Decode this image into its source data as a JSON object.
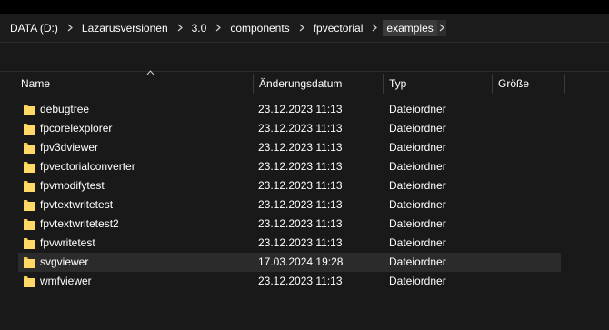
{
  "breadcrumb": {
    "items": [
      "DATA (D:)",
      "Lazarusversionen",
      "3.0",
      "components",
      "fpvectorial",
      "examples"
    ]
  },
  "columns": {
    "name": "Name",
    "date": "Änderungsdatum",
    "type": "Typ",
    "size": "Größe"
  },
  "files": [
    {
      "name": "debugtree",
      "date": "23.12.2023 11:13",
      "type": "Dateiordner",
      "size": ""
    },
    {
      "name": "fpcorelexplorer",
      "date": "23.12.2023 11:13",
      "type": "Dateiordner",
      "size": ""
    },
    {
      "name": "fpv3dviewer",
      "date": "23.12.2023 11:13",
      "type": "Dateiordner",
      "size": ""
    },
    {
      "name": "fpvectorialconverter",
      "date": "23.12.2023 11:13",
      "type": "Dateiordner",
      "size": ""
    },
    {
      "name": "fpvmodifytest",
      "date": "23.12.2023 11:13",
      "type": "Dateiordner",
      "size": ""
    },
    {
      "name": "fpvtextwritetest",
      "date": "23.12.2023 11:13",
      "type": "Dateiordner",
      "size": ""
    },
    {
      "name": "fpvtextwritetest2",
      "date": "23.12.2023 11:13",
      "type": "Dateiordner",
      "size": ""
    },
    {
      "name": "fpvwritetest",
      "date": "23.12.2023 11:13",
      "type": "Dateiordner",
      "size": ""
    },
    {
      "name": "svgviewer",
      "date": "17.03.2024 19:28",
      "type": "Dateiordner",
      "size": "",
      "selected": true
    },
    {
      "name": "wmfviewer",
      "date": "23.12.2023 11:13",
      "type": "Dateiordner",
      "size": ""
    }
  ],
  "icons": {
    "breadcrumb_separator": "chevron-right-icon",
    "sort_indicator": "sort-ascending-icon",
    "file_icon": "folder-icon"
  },
  "colors": {
    "background": "#191919",
    "selected_row": "#2b2b2b",
    "folder": "#f4c74b"
  }
}
